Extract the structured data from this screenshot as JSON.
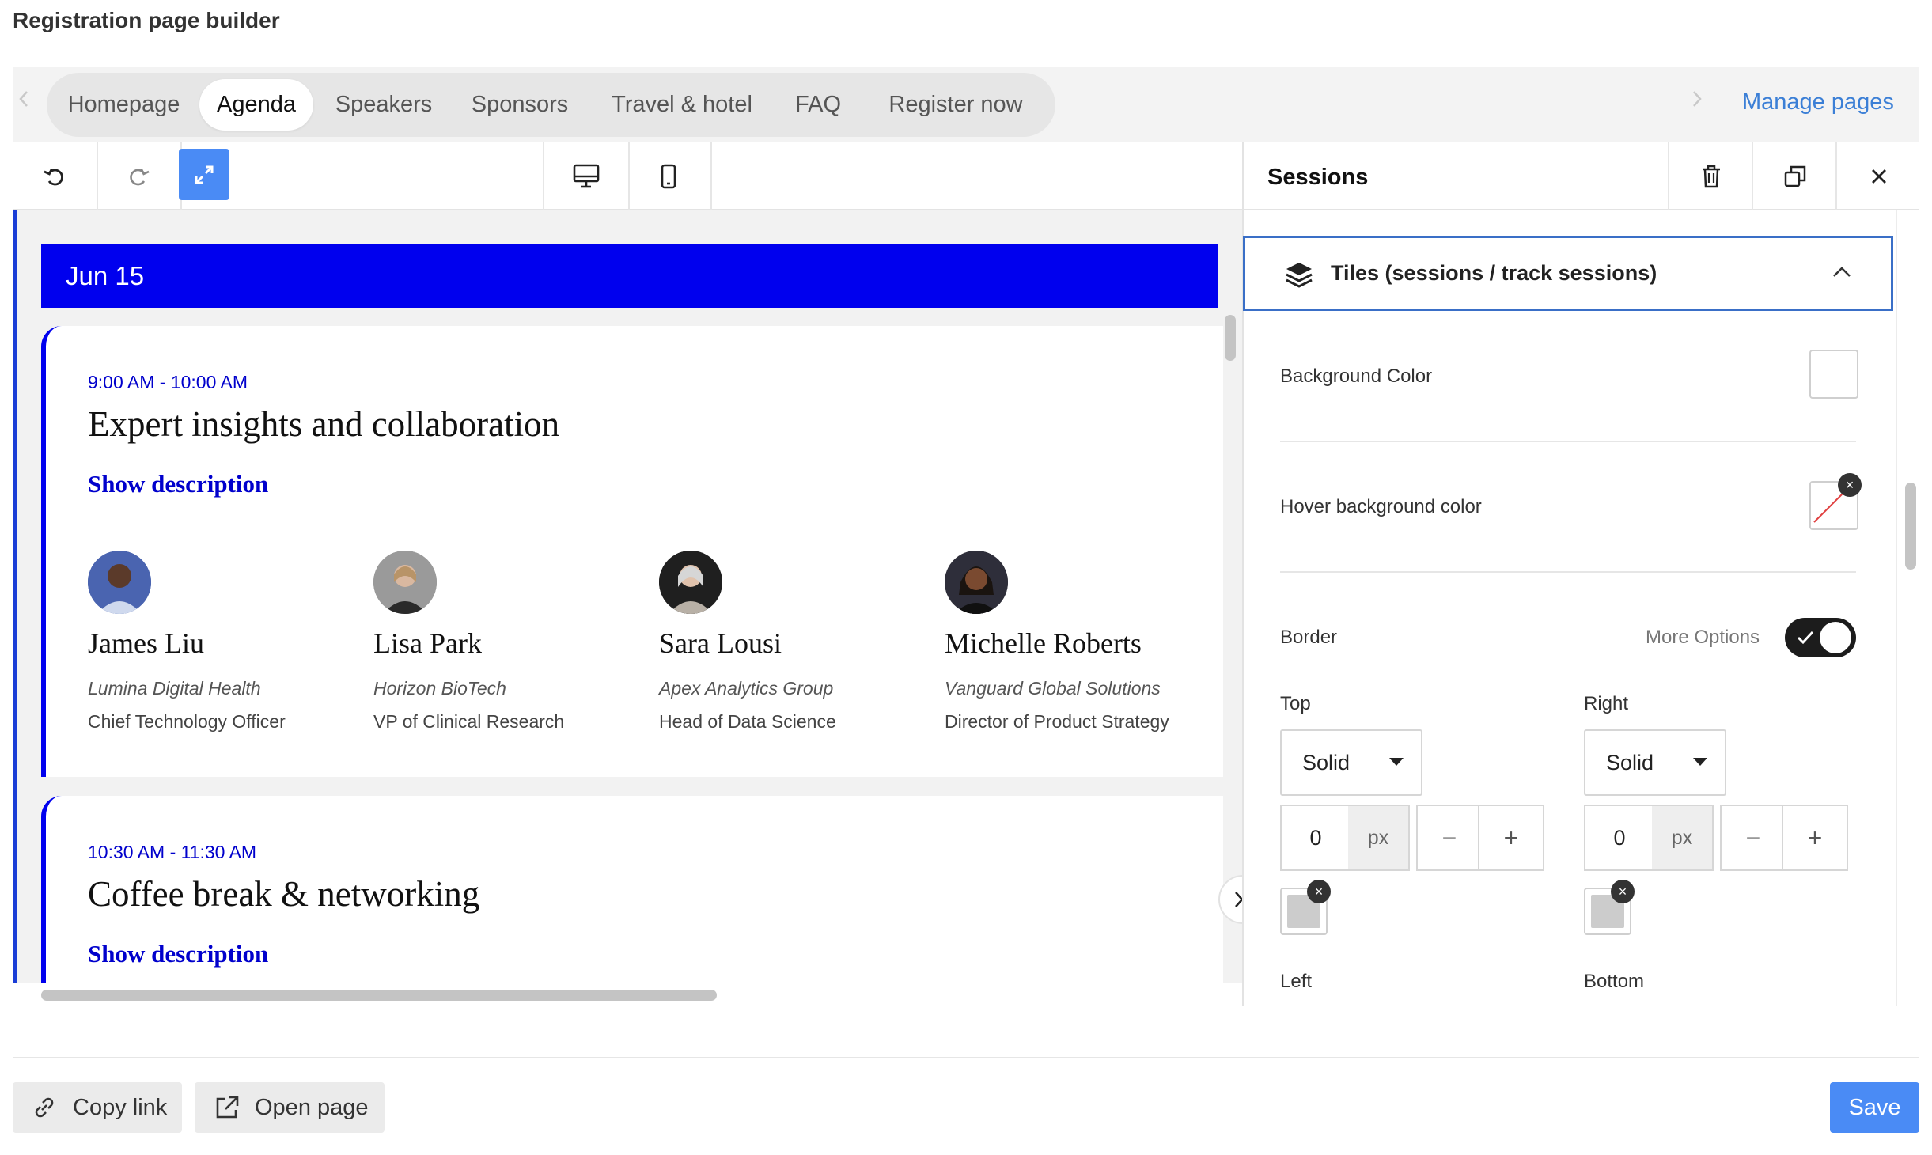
{
  "header": {
    "title": "Registration page builder"
  },
  "tabs": {
    "items": [
      {
        "label": "Homepage"
      },
      {
        "label": "Agenda"
      },
      {
        "label": "Speakers"
      },
      {
        "label": "Sponsors"
      },
      {
        "label": "Travel & hotel"
      },
      {
        "label": "FAQ"
      },
      {
        "label": "Register now"
      }
    ],
    "active": "Agenda",
    "manage_label": "Manage pages"
  },
  "preview": {
    "date_label": "Jun 15",
    "sessions": [
      {
        "time": "9:00 AM - 10:00 AM",
        "title": "Expert insights and collaboration",
        "desc_link": "Show description",
        "speakers": [
          {
            "name": "James Liu",
            "org": "Lumina Digital Health",
            "role": "Chief Technology Officer"
          },
          {
            "name": "Lisa Park",
            "org": "Horizon BioTech",
            "role": "VP of Clinical Research"
          },
          {
            "name": "Sara Lousi",
            "org": "Apex Analytics Group",
            "role": "Head of Data Science"
          },
          {
            "name": "Michelle Roberts",
            "org": "Vanguard Global Solutions",
            "role": "Director of Product Strategy"
          }
        ]
      },
      {
        "time": "10:30 AM - 11:30 AM",
        "title": "Coffee break & networking",
        "desc_link": "Show description"
      }
    ]
  },
  "panel": {
    "title": "Sessions",
    "section_title": "Tiles (sessions / track sessions)",
    "background_color_label": "Background Color",
    "hover_bg_label": "Hover background color",
    "border_label": "Border",
    "more_options_label": "More Options",
    "more_options_on": true,
    "sides": {
      "top": {
        "label": "Top",
        "style": "Solid",
        "width": "0",
        "unit": "px"
      },
      "right": {
        "label": "Right",
        "style": "Solid",
        "width": "0",
        "unit": "px"
      },
      "left": {
        "label": "Left"
      },
      "bottom": {
        "label": "Bottom"
      }
    },
    "minus": "−",
    "plus": "+"
  },
  "footer": {
    "copy_link": "Copy link",
    "open_page": "Open page",
    "save": "Save"
  },
  "colors": {
    "accent_blue": "#0000ee",
    "button_blue": "#4a8bf5",
    "link_blue": "#3b7fd6",
    "focus_border": "#3a6fc7"
  }
}
